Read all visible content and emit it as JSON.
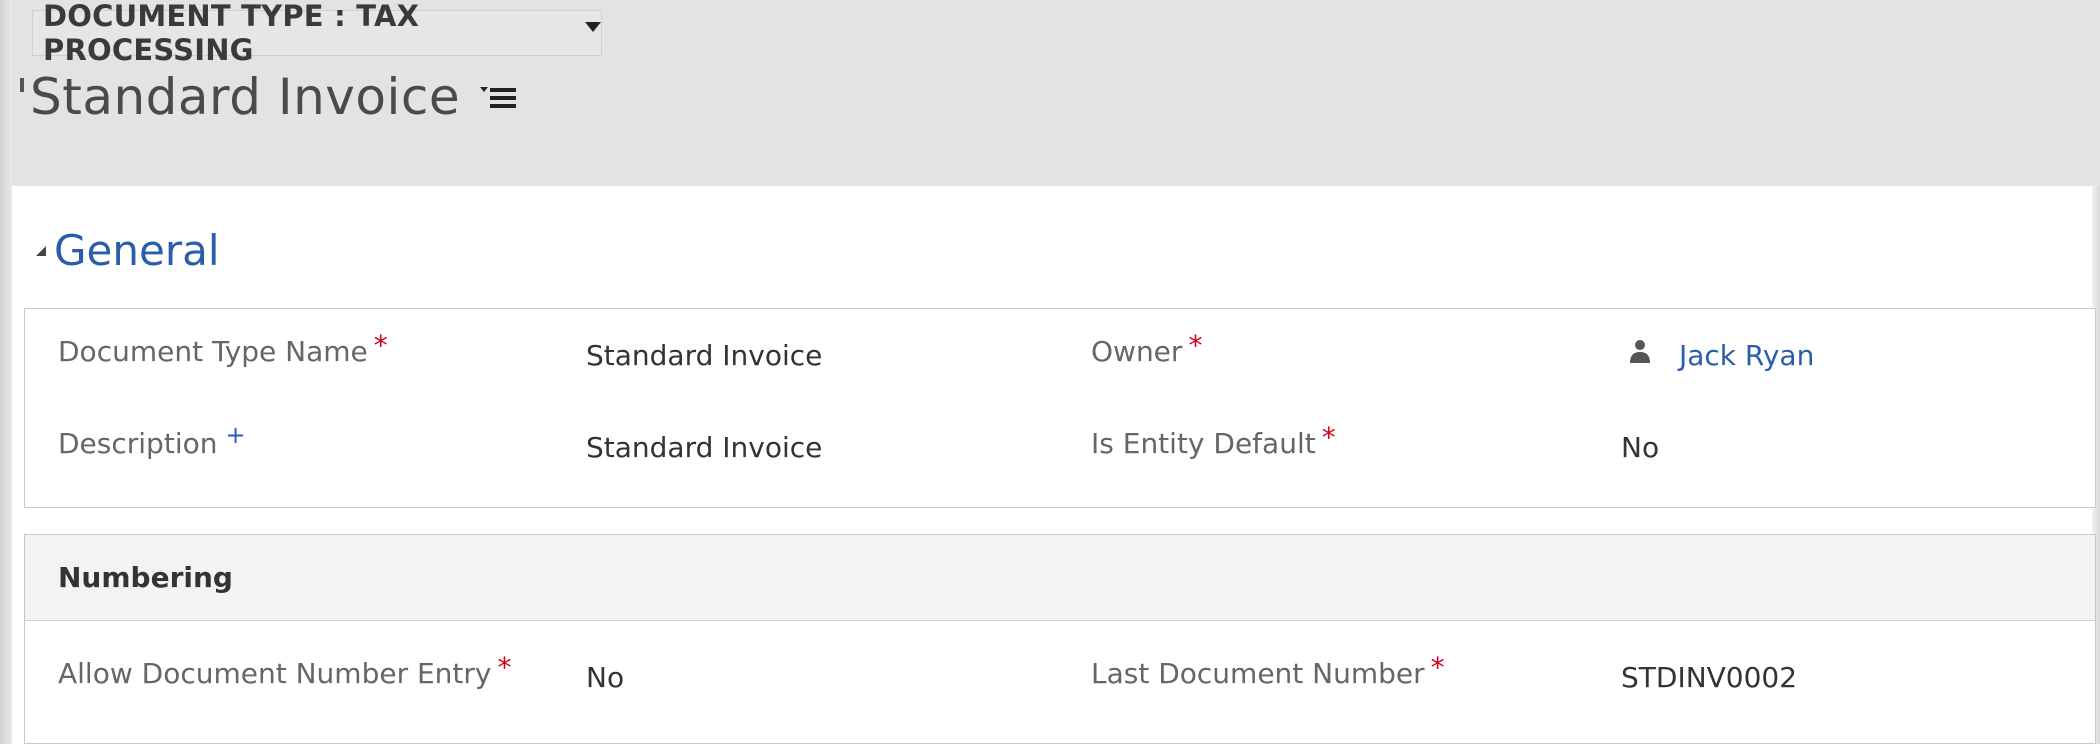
{
  "header": {
    "doc_type_label": "DOCUMENT TYPE : TAX PROCESSING",
    "record_title": "Standard Invoice"
  },
  "general": {
    "section_title": "General",
    "fields": {
      "document_type_name": {
        "label": "Document Type Name",
        "value": "Standard Invoice",
        "required": "*"
      },
      "description": {
        "label": "Description",
        "value": "Standard Invoice",
        "recommended": "+"
      },
      "owner": {
        "label": "Owner",
        "value": "Jack Ryan",
        "required": "*",
        "icon": "user-icon"
      },
      "is_entity_default": {
        "label": "Is Entity Default",
        "value": "No",
        "required": "*"
      }
    }
  },
  "numbering": {
    "section_title": "Numbering",
    "fields": {
      "allow_document_number_entry": {
        "label": "Allow Document Number Entry",
        "value": "No",
        "required": "*"
      },
      "last_document_number": {
        "label": "Last Document Number",
        "value": "STDINV0002",
        "required": "*"
      }
    }
  },
  "colors": {
    "header_bg": "#e3e3e3",
    "section_title": "#2b5ea8",
    "required_marker": "#d0021b",
    "recommended_marker": "#1f5fbf"
  }
}
